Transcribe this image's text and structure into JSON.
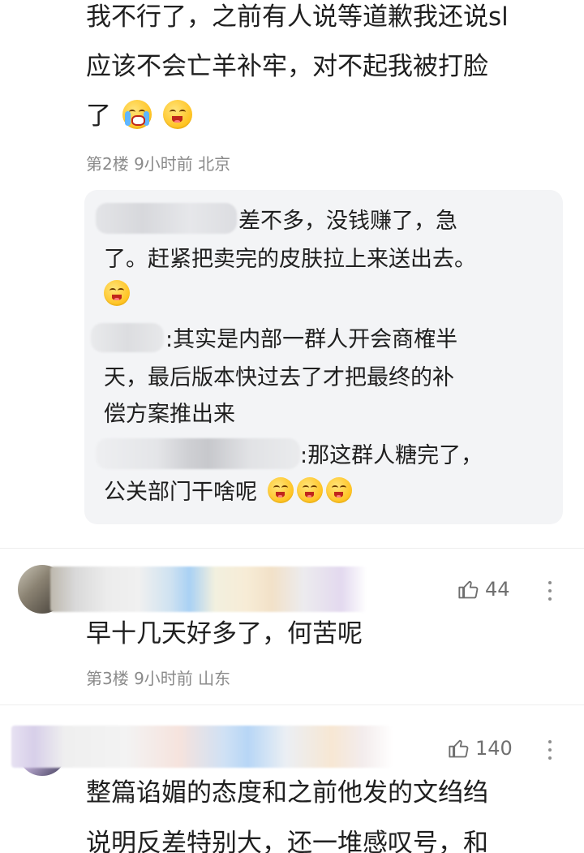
{
  "comments": [
    {
      "lines": [
        "我不行了，之前有人说等道歉我还说sl",
        "应该不会亡羊补牢，对不起我被打脸",
        "了"
      ],
      "emojis": [
        "crying-laugh-icon",
        "laugh-icon"
      ],
      "meta": "第2楼 9小时前 北京",
      "replies": [
        {
          "lines": [
            "差不多，没钱赚了，急",
            "了。赶紧把卖完的皮肤拉上来送出去。"
          ],
          "emojis": [
            "laugh-icon"
          ]
        },
        {
          "lines": [
            ":其实是内部一群人开会商榷半",
            "天，最后版本快过去了才把最终的补",
            "偿方案推出来"
          ],
          "emojis": []
        },
        {
          "lines": [
            ":那这群人糖完了，",
            "公关部门干啥呢"
          ],
          "emojis": [
            "laugh-icon",
            "laugh-icon",
            "laugh-icon"
          ]
        }
      ]
    },
    {
      "likes": "44",
      "text": "早十几天好多了，何苦呢",
      "meta": "第3楼 9小时前 山东"
    },
    {
      "likes": "140",
      "lines": [
        "整篇谄媚的态度和之前他发的文绉绉",
        "说明反差特别大，还一堆感叹号，和"
      ]
    }
  ]
}
